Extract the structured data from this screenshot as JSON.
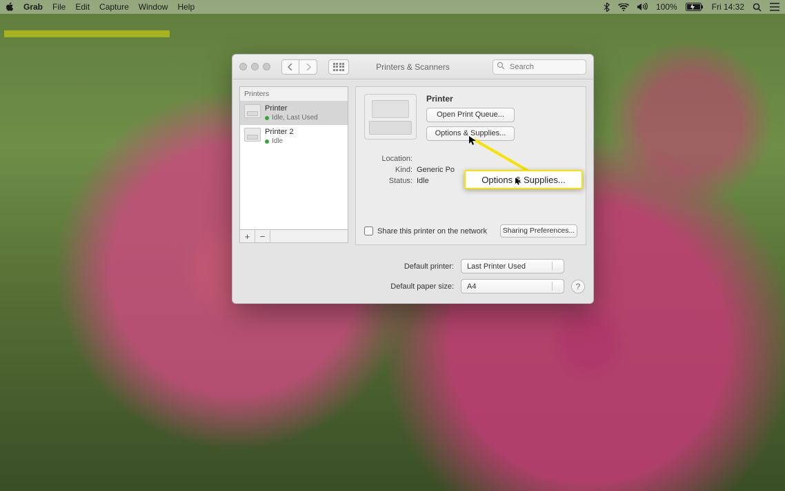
{
  "menubar": {
    "app": "Grab",
    "items": [
      "File",
      "Edit",
      "Capture",
      "Window",
      "Help"
    ],
    "battery_pct": "100%",
    "clock": "Fri 14:32"
  },
  "window": {
    "title": "Printers & Scanners",
    "search_placeholder": "Search"
  },
  "sidebar": {
    "header": "Printers",
    "printers": [
      {
        "name": "Printer",
        "status": "Idle, Last Used"
      },
      {
        "name": "Printer 2",
        "status": "Idle"
      }
    ]
  },
  "main": {
    "heading": "Printer",
    "open_queue": "Open Print Queue...",
    "options_supplies": "Options & Supplies...",
    "location_label": "Location:",
    "location_value": "",
    "kind_label": "Kind:",
    "kind_value": "Generic Po",
    "status_label": "Status:",
    "status_value": "Idle",
    "share_label": "Share this printer on the network",
    "sharing_prefs": "Sharing Preferences..."
  },
  "bottom": {
    "default_printer_label": "Default printer:",
    "default_printer_value": "Last Printer Used",
    "paper_size_label": "Default paper size:",
    "paper_size_value": "A4"
  },
  "callout": {
    "text": "Options & Supplies..."
  }
}
